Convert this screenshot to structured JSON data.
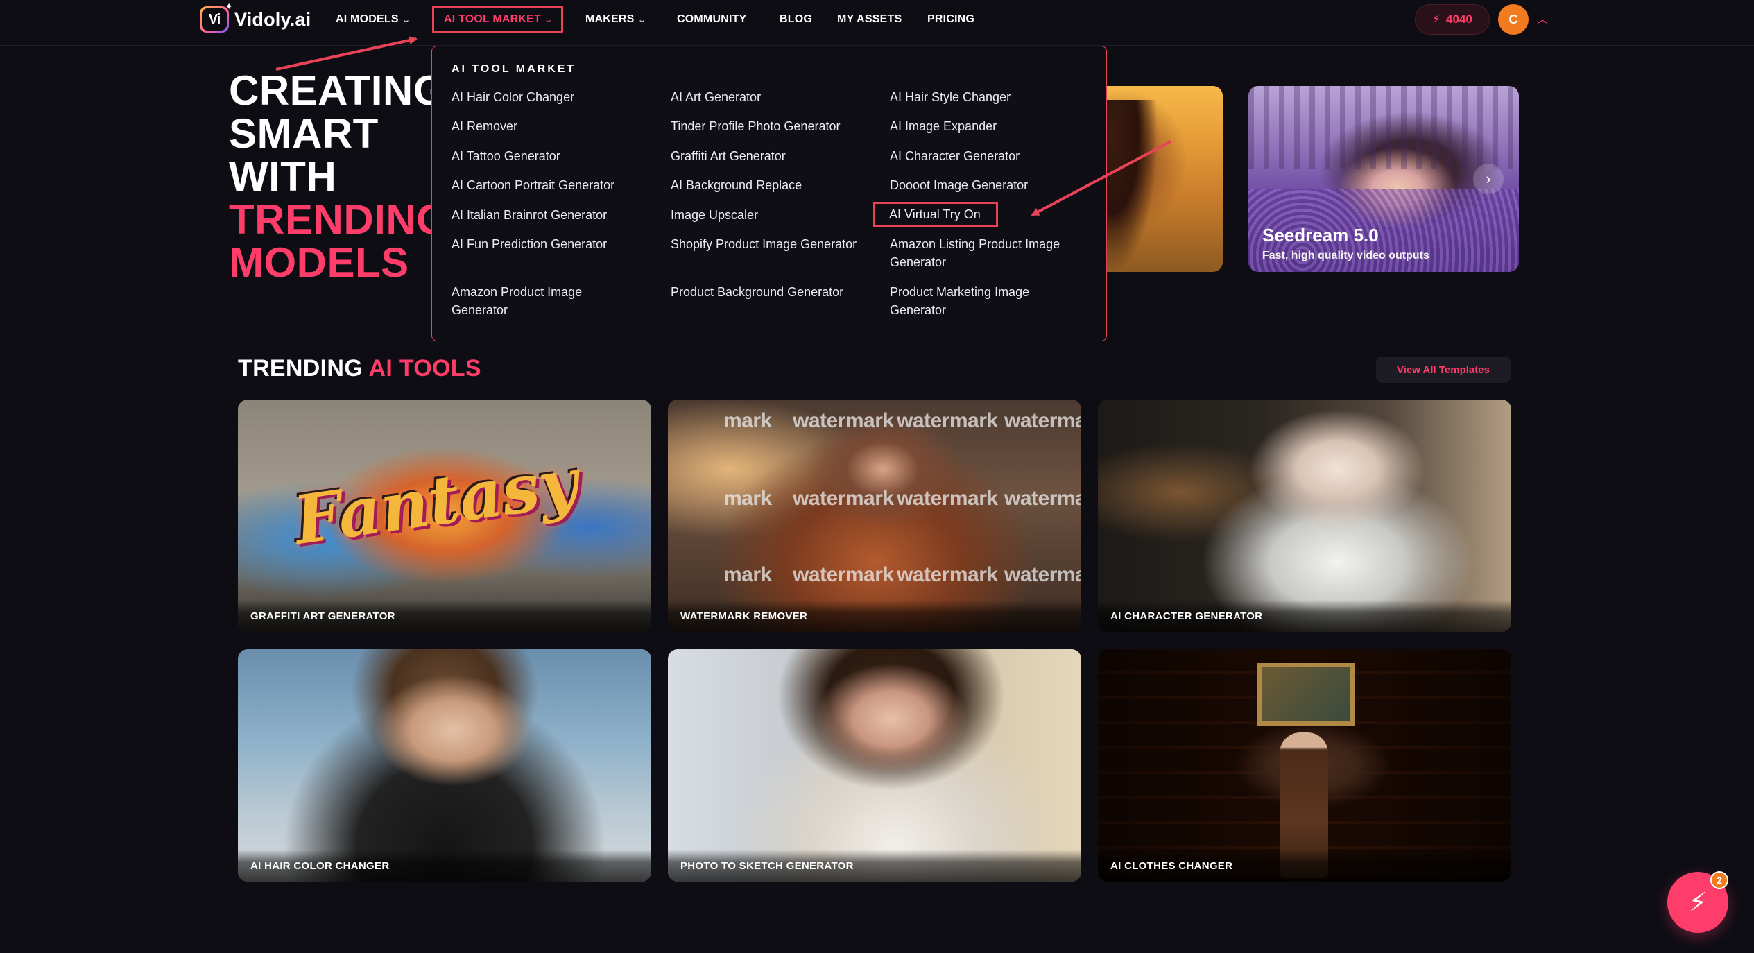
{
  "brand": {
    "logo_mark": "Vi",
    "name": "Vidoly.ai"
  },
  "nav": {
    "items": [
      {
        "label": "AI MODELS",
        "has_dropdown": true
      },
      {
        "label": "AI TOOL MARKET",
        "has_dropdown": true,
        "active": true
      },
      {
        "label": "MAKERS",
        "has_dropdown": true
      },
      {
        "label": "COMMUNITY"
      },
      {
        "label": "BLOG"
      },
      {
        "label": "MY ASSETS"
      },
      {
        "label": "PRICING"
      }
    ],
    "credits": "4040",
    "avatar_initial": "C"
  },
  "hero": {
    "title_lines": [
      "CREATING",
      "SMART",
      "WITH",
      "TRENDING",
      "MODELS"
    ],
    "card_title": "Seedream 5.0",
    "card_subtitle": "Fast, high quality video outputs"
  },
  "dropdown": {
    "title": "AI TOOL MARKET",
    "columns": [
      [
        "AI Hair Color Changer",
        "AI Remover",
        "AI Tattoo Generator",
        "AI Cartoon Portrait Generator",
        "AI Italian Brainrot Generator",
        "AI Fun Prediction Generator",
        "Amazon Product Image Generator"
      ],
      [
        "AI Art Generator",
        "Tinder Profile Photo Generator",
        "Graffiti Art Generator",
        "AI Background Replace",
        "Image Upscaler",
        "Shopify Product Image Generator",
        "Product Background Generator"
      ],
      [
        "AI Hair Style Changer",
        "AI Image Expander",
        "AI Character Generator",
        "Doooot Image Generator",
        "AI Virtual Try On",
        "Amazon Listing Product Image Generator",
        "Product Marketing Image Generator"
      ]
    ]
  },
  "trending": {
    "title_white": "TRENDING",
    "title_pink": "AI TOOLS",
    "view_all": "View All Templates",
    "cards": [
      {
        "label": "GRAFFITI ART GENERATOR",
        "art_text": "Fantasy"
      },
      {
        "label": "WATERMARK REMOVER",
        "watermark": [
          "mark",
          "watermark",
          "watermark",
          "watermarl"
        ]
      },
      {
        "label": "AI CHARACTER GENERATOR"
      },
      {
        "label": "AI HAIR COLOR CHANGER"
      },
      {
        "label": "PHOTO TO SKETCH GENERATOR"
      },
      {
        "label": "AI CLOTHES CHANGER"
      }
    ]
  },
  "fab": {
    "badge": "2",
    "icon": "lightning-icon"
  },
  "colors": {
    "accent": "#ff3d6a",
    "highlight_border": "#e84356",
    "background": "#0e0d14",
    "avatar": "#f27b1f"
  }
}
